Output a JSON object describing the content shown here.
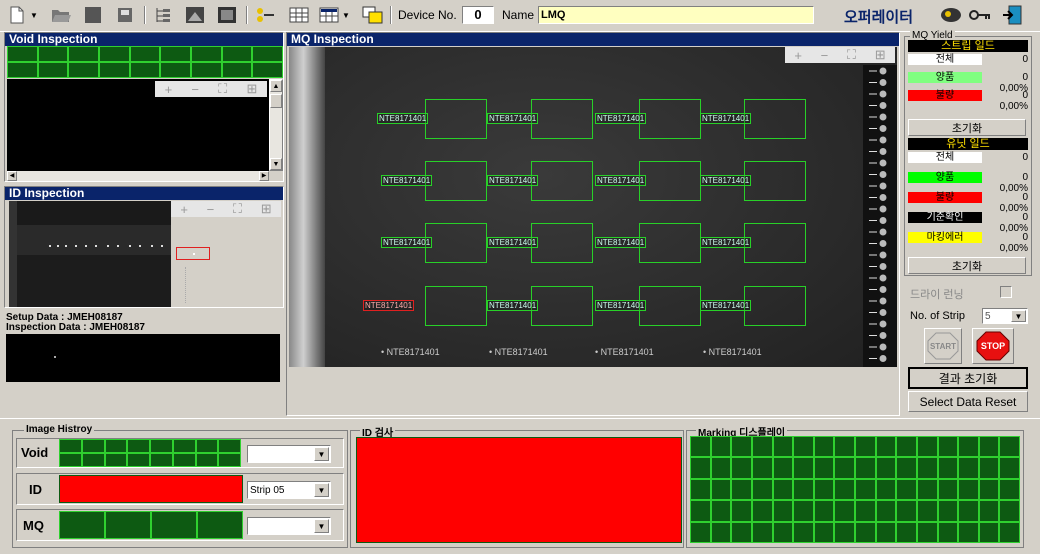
{
  "toolbar": {
    "device_label": "Device No.",
    "device_value": "0",
    "name_label": "Name",
    "name_value": "LMQ",
    "operator_label": "오퍼레이터",
    "icons": [
      "new-file-icon",
      "open-folder-icon",
      "save-icon",
      "print-icon",
      "tree-icon",
      "image-icon",
      "report-icon",
      "toggle-icon",
      "table-icon",
      "grid-icon",
      "window-icon",
      "user-icon",
      "key-icon",
      "exit-icon"
    ]
  },
  "void_panel": {
    "title": "Void Inspection"
  },
  "id_panel": {
    "title": "ID Inspection",
    "setup_data": "Setup Data : JMEH08187",
    "inspection_data": "Inspection Data : JMEH08187"
  },
  "mq_panel": {
    "title": "MQ Inspection",
    "marking_text": "NTE8171401",
    "bottom_labels": [
      "• NTE8171401",
      "• NTE8171401",
      "• NTE8171401",
      "• NTE8171401"
    ]
  },
  "mini_toolbar": {
    "zoom_in": "+",
    "zoom_out": "−",
    "fit": "⛶",
    "full": "⊞"
  },
  "yield": {
    "group_title": "MQ Yield",
    "strip_title": "스트립 일드",
    "strip_rows": [
      {
        "label": "전체",
        "value": "0",
        "pct": ""
      },
      {
        "label": "양품",
        "value": "0",
        "pct": "0,00%"
      },
      {
        "label": "불량",
        "value": "0",
        "pct": "0,00%"
      }
    ],
    "reset1": "초기화",
    "unit_title": "유닛 일드",
    "unit_rows": [
      {
        "label": "전체",
        "value": "0",
        "pct": ""
      },
      {
        "label": "양품",
        "value": "0",
        "pct": "0,00%"
      },
      {
        "label": "불량",
        "value": "0",
        "pct": "0,00%"
      },
      {
        "label": "기준확인",
        "value": "0",
        "pct": "0,00%"
      },
      {
        "label": "마킹에러",
        "value": "0",
        "pct": "0,00%"
      }
    ],
    "reset2": "초기화"
  },
  "controls": {
    "dry_run": "드라이 런닝",
    "no_of_strip": "No. of Strip",
    "strip_count": "5",
    "start": "START",
    "stop": "STOP",
    "result_reset": "결과 초기화",
    "select_data_reset": "Select Data Reset"
  },
  "history": {
    "title": "Image Histroy",
    "void_label": "Void",
    "id_label": "ID",
    "mq_label": "MQ",
    "void_combo": "",
    "id_combo": "Strip 05",
    "mq_combo": ""
  },
  "id_check": {
    "title": "ID 검사"
  },
  "marking_display": {
    "title": "Marking 디스플레이"
  },
  "colors": {
    "grid_green": "#0d5a12",
    "grid_line": "#2fd02f",
    "title_blue": "#0a246a",
    "alert_red": "#ff0000",
    "good_green": "#00ff00"
  }
}
